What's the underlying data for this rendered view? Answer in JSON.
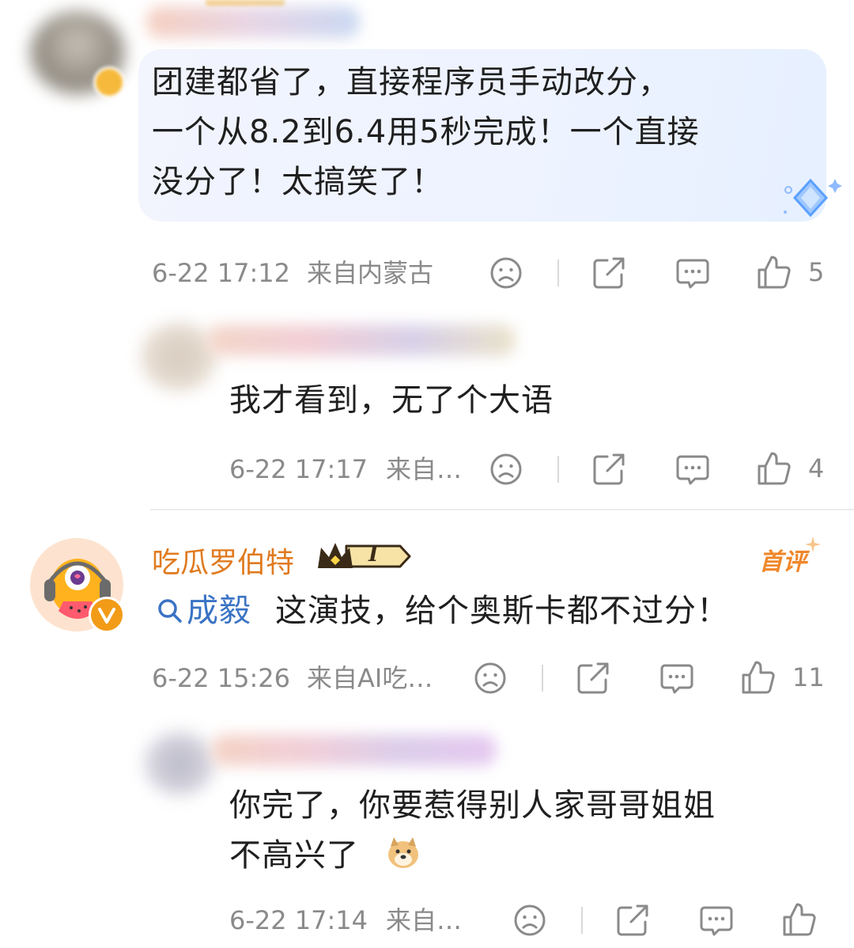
{
  "comments": [
    {
      "text_lines": [
        "团建都省了，直接程序员手动改分，",
        "一个从8.2到6.4用5秒完成！一个直接",
        "没分了！太搞笑了！"
      ],
      "time": "6-22 17:12",
      "location": "来自内蒙古",
      "likes": "5"
    },
    {
      "text_lines": [
        "我才看到，无了个大语"
      ],
      "time": "6-22 17:17",
      "location": "来自…",
      "likes": "4"
    },
    {
      "username": "吃瓜罗伯特",
      "level_badge": "I",
      "first_tag": "首评",
      "mention": "成毅",
      "text": "这演技，给个奥斯卡都不过分！",
      "time": "6-22 15:26",
      "location": "来自AI吃…",
      "likes": "11"
    },
    {
      "text_lines": [
        "你完了，你要惹得别人家哥哥姐姐",
        "不高兴了"
      ],
      "time": "6-22 17:14",
      "location": "来自…",
      "likes": ""
    }
  ],
  "colors": {
    "username": "#e07a1f",
    "mention": "#3a73c4",
    "meta": "#8a8a8a",
    "bubble": "#eef3ff"
  },
  "icons": [
    "dislike-face-icon",
    "share-icon",
    "comment-icon",
    "like-thumb-icon",
    "search-icon",
    "doge-emoji-icon",
    "vip-v-badge-icon",
    "crown-level-badge-icon",
    "diamond-sparkle-icon"
  ]
}
